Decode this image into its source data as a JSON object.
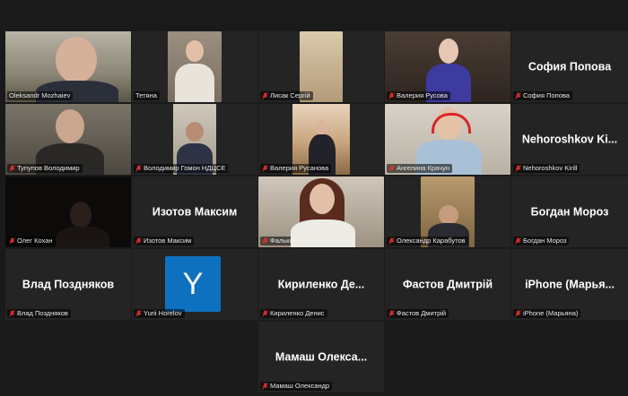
{
  "participants": [
    {
      "name": "Oleksandr Mozhaiev",
      "muted": false
    },
    {
      "name": "Тетяна",
      "muted": false
    },
    {
      "name": "Лисак Сергій",
      "muted": true
    },
    {
      "name": "Валерия Русова",
      "muted": true
    },
    {
      "name": "София Попова",
      "muted": true,
      "display_name": "София Попова"
    },
    {
      "name": "Тупупов Володимир",
      "muted": true
    },
    {
      "name": "Володимир Гомон НДЦСЕ",
      "muted": true
    },
    {
      "name": "Валерия Русанова",
      "muted": true
    },
    {
      "name": "Ангелина Крачун",
      "muted": true
    },
    {
      "name": "Nehoroshkov Kirill",
      "muted": true,
      "display_name": "Nehoroshkov Ki..."
    },
    {
      "name": "Олег Кохан",
      "muted": true
    },
    {
      "name": "Изотов Максим",
      "muted": true,
      "display_name": "Изотов Максим"
    },
    {
      "name": "Фалько Олена",
      "muted": true
    },
    {
      "name": "Олександр Карабутов",
      "muted": true
    },
    {
      "name": "Богдан Мороз",
      "muted": true,
      "display_name": "Богдан Мороз"
    },
    {
      "name": "Влад Поздняков",
      "muted": true,
      "display_name": "Влад Поздняков"
    },
    {
      "name": "Yurii Horelov",
      "muted": true,
      "avatar_letter": "Y"
    },
    {
      "name": "Кириленко Денис",
      "muted": true,
      "display_name": "Кириленко Де..."
    },
    {
      "name": "Фастов Дмитрій",
      "muted": true,
      "display_name": "Фастов Дмитрій"
    },
    {
      "name": "iPhone (Марьяна)",
      "muted": true,
      "display_name": "iPhone (Марья..."
    },
    {
      "name": "Мамаш Олександр",
      "muted": true,
      "display_name": "Мамаш Олекса..."
    }
  ],
  "colors": {
    "background": "#1a1a1a",
    "tile": "#242424",
    "active_border": "#c9e45a",
    "muted_icon": "#e0302f",
    "avatar": "#0e71c0"
  }
}
